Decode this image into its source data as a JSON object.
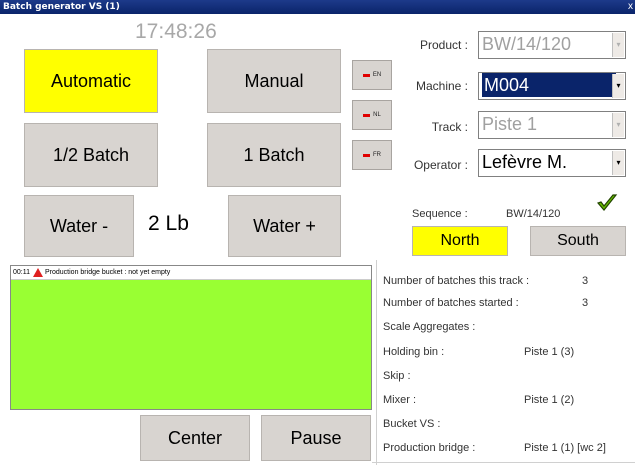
{
  "window": {
    "title": "Batch generator VS (1)",
    "close_label": "x"
  },
  "clock": "17:48:26",
  "buttons": {
    "automatic": "Automatic",
    "manual": "Manual",
    "half_batch": "1/2 Batch",
    "one_batch": "1 Batch",
    "water_minus": "Water -",
    "water_plus": "Water +",
    "center": "Center",
    "pause": "Pause",
    "north": "North",
    "south": "South"
  },
  "water_amount": "2 Lb",
  "languages": [
    "EN",
    "NL",
    "FR"
  ],
  "form": {
    "product": {
      "label": "Product :",
      "value": "BW/14/120"
    },
    "machine": {
      "label": "Machine :",
      "value": "M004"
    },
    "track": {
      "label": "Track :",
      "value": "Piste 1"
    },
    "operator": {
      "label": "Operator :",
      "value": "Lefèvre M."
    }
  },
  "sequence": {
    "label": "Sequence :",
    "value": "BW/14/120"
  },
  "message": {
    "time": "00:11",
    "text": "Production bridge bucket : not yet empty"
  },
  "status": [
    {
      "label": "Number of batches this track :",
      "value": "3"
    },
    {
      "label": "Number of batches started :",
      "value": "3"
    },
    {
      "label": "Scale Aggregates :",
      "value": ""
    },
    {
      "label": "Holding bin :",
      "value": "Piste 1 (3)"
    },
    {
      "label": "Skip :",
      "value": ""
    },
    {
      "label": "Mixer :",
      "value": "Piste 1 (2)"
    },
    {
      "label": "Bucket VS :",
      "value": ""
    },
    {
      "label": "Production bridge :",
      "value": "Piste 1 (1) [wc 2]"
    }
  ],
  "colors": {
    "active": "#ffff00",
    "message_bg": "#99ff33",
    "titlebar": "#0a246a"
  }
}
